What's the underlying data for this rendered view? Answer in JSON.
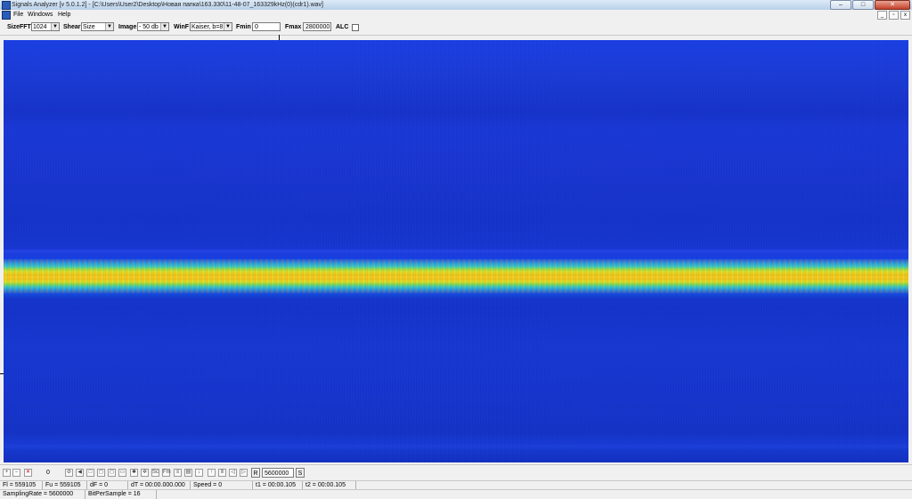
{
  "window": {
    "title": "Signals Analyzer [v 5.0.1.2] - [C:\\Users\\User2\\Desktop\\Новая папка\\163.330\\11-48-07_163329kHz(0)(cdr1).wav]",
    "min_glyph": "–",
    "max_glyph": "□",
    "close_glyph": "✕"
  },
  "menu": {
    "items": [
      "File",
      "Windows",
      "Help"
    ],
    "mdi_min": "_",
    "mdi_restore": "▫",
    "mdi_close": "x"
  },
  "toolbar": {
    "sizefft_label": "SizeFFT",
    "sizefft_value": "1024",
    "shear_label": "Shear",
    "shear_value": "Size",
    "image_label": "Image",
    "image_value": "- 50 db",
    "winf_label": "WinF",
    "winf_value": "Kaiser, b=8",
    "fmin_label": "Fmin",
    "fmin_value": "0",
    "fmax_label": "Fmax",
    "fmax_value": "2800000",
    "alc_label": "ALC",
    "alc_checked": false
  },
  "bottom_toolbar": {
    "counter_value": "0",
    "rate_label": "R",
    "rate_value": "5600000",
    "s_label": "S"
  },
  "status": {
    "fl": "Fl = 559105",
    "fu": "Fu = 559105",
    "df": "dF = 0",
    "dt": "dT = 00:00.000.000",
    "speed": "Speed = 0",
    "t1": "t1 = 00:00.105",
    "t2": "t2 = 00:00.105",
    "sampling_rate": "SamplingRate = 5600000",
    "bits_per_sample": "BitPerSample = 16"
  }
}
